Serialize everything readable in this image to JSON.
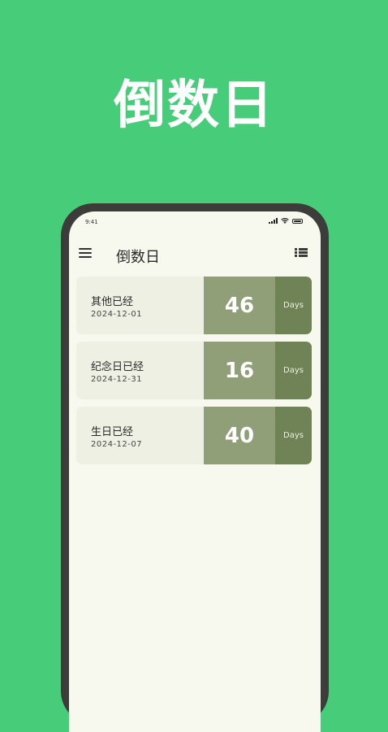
{
  "hero_title": "倒数日",
  "status_bar": {
    "time": "9:41"
  },
  "app_bar": {
    "title": "倒数日",
    "menu_icon": "hamburger-menu-icon",
    "view_icon": "list-view-icon"
  },
  "colors": {
    "background": "#47cc79",
    "screen": "#f7f8ee",
    "card_left": "#eef0e3",
    "card_number": "#919f78",
    "card_unit": "#6f8356"
  },
  "events": [
    {
      "title": "其他已经",
      "date": "2024-12-01",
      "days": "46",
      "unit": "Days"
    },
    {
      "title": "纪念日已经",
      "date": "2024-12-31",
      "days": "16",
      "unit": "Days"
    },
    {
      "title": "生日已经",
      "date": "2024-12-07",
      "days": "40",
      "unit": "Days"
    }
  ]
}
